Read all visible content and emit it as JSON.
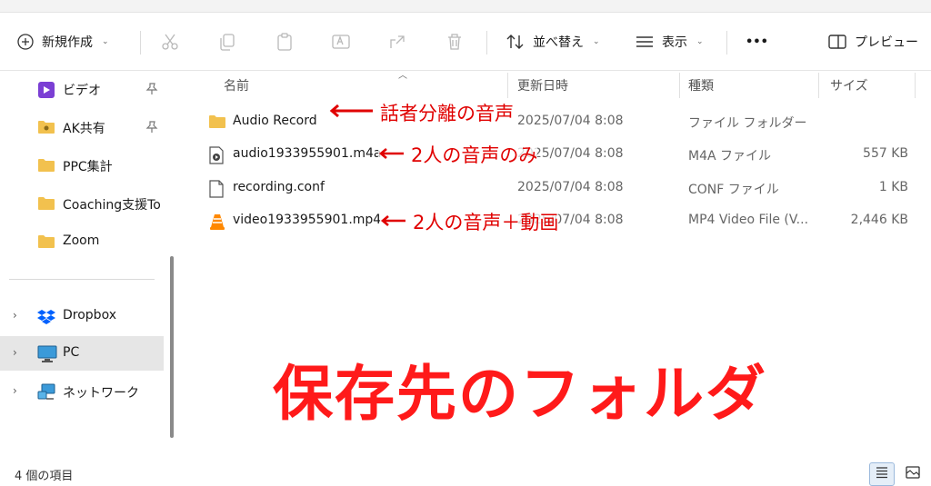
{
  "toolbar": {
    "new_label": "新規作成",
    "sort_label": "並べ替え",
    "view_label": "表示",
    "more_label": "•••",
    "preview_label": "プレビュー"
  },
  "sidebar": {
    "items": [
      {
        "label": "ビデオ",
        "icon": "video-folder-icon",
        "pinned": true
      },
      {
        "label": "AK共有",
        "icon": "shared-folder-icon",
        "pinned": true
      },
      {
        "label": "PPC集計",
        "icon": "folder-icon"
      },
      {
        "label": "Coaching支援To",
        "icon": "folder-icon"
      },
      {
        "label": "Zoom",
        "icon": "folder-icon"
      },
      {
        "label": "Dropbox",
        "icon": "dropbox-icon"
      },
      {
        "label": "PC",
        "icon": "pc-icon"
      },
      {
        "label": "ネットワーク",
        "icon": "network-icon"
      }
    ]
  },
  "columns": {
    "name": "名前",
    "date": "更新日時",
    "type": "種類",
    "size": "サイズ"
  },
  "files": [
    {
      "name": "Audio Record",
      "date": "2025/07/04 8:08",
      "type": "ファイル フォルダー",
      "size": "",
      "icon": "folder-icon"
    },
    {
      "name": "audio1933955901.m4a",
      "date": "2025/07/04 8:08",
      "type": "M4A ファイル",
      "size": "557 KB",
      "icon": "audio-file-icon"
    },
    {
      "name": "recording.conf",
      "date": "2025/07/04 8:08",
      "type": "CONF ファイル",
      "size": "1 KB",
      "icon": "document-icon"
    },
    {
      "name": "video1933955901.mp4",
      "date": "2025/07/04 8:08",
      "type": "MP4 Video File (V...",
      "size": "2,446 KB",
      "icon": "vlc-icon"
    }
  ],
  "annotations": {
    "a1": "話者分離の音声",
    "a2": "2人の音声のみ",
    "a3": "2人の音声＋動画",
    "caption": "保存先のフォルダ"
  },
  "status": {
    "count": "4 個の項目"
  },
  "colors": {
    "annotation": "#e00000",
    "folder": "#f2c14e",
    "selected_bg": "#e6e6e6"
  }
}
